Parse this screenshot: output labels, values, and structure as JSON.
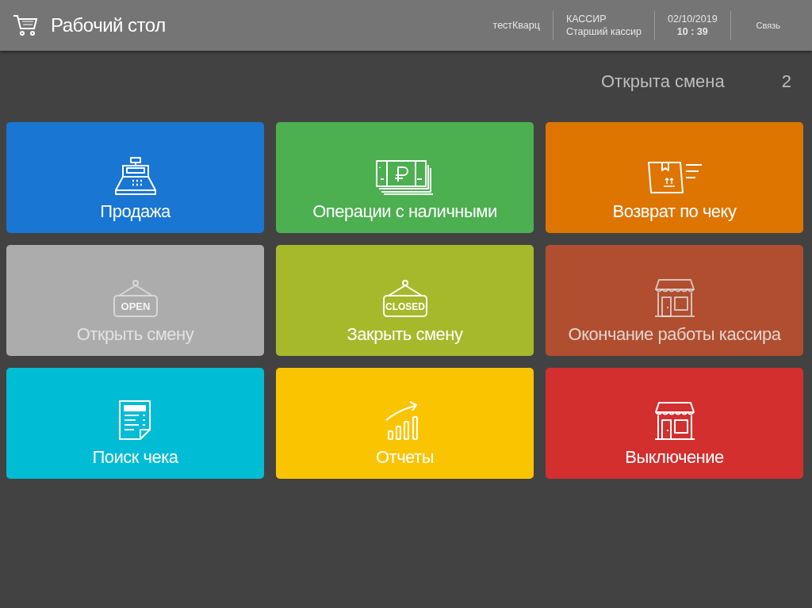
{
  "header": {
    "title": "Рабочий стол",
    "store": "тестКварц",
    "role": "КАССИР",
    "position": "Старший кассир",
    "date": "02/10/2019",
    "time": "10 : 39",
    "connection": "Связь"
  },
  "shift": {
    "label": "Открыта смена",
    "number": "2"
  },
  "tiles": [
    {
      "label": "Продажа",
      "kind": "register",
      "color": "#1976d2",
      "disabled": false
    },
    {
      "label": "Операции с наличными",
      "kind": "cash",
      "color": "#4caf50",
      "disabled": false
    },
    {
      "label": "Возврат по чеку",
      "kind": "return",
      "color": "#dd7500",
      "disabled": false
    },
    {
      "label": "Открыть смену",
      "kind": "sign",
      "sign_text": "OPEN",
      "color": "#acacac",
      "disabled": true
    },
    {
      "label": "Закрыть смену",
      "kind": "sign",
      "sign_text": "CLOSED",
      "color": "#a6b92b",
      "disabled": false
    },
    {
      "label": "Окончание работы кассира",
      "kind": "store",
      "color": "#b04e2f",
      "disabled": true
    },
    {
      "label": "Поиск чека",
      "kind": "receipt",
      "color": "#00bcd4",
      "disabled": false
    },
    {
      "label": "Отчеты",
      "kind": "chart",
      "color": "#fbc400",
      "disabled": false
    },
    {
      "label": "Выключение",
      "kind": "store",
      "color": "#d32f2f",
      "disabled": false
    }
  ]
}
